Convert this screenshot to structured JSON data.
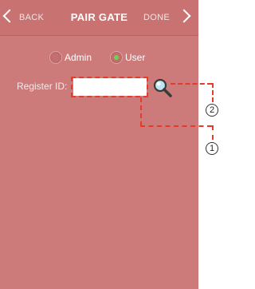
{
  "header": {
    "back_label": "BACK",
    "title": "PAIR GATE",
    "done_label": "DONE"
  },
  "role_selector": {
    "options": [
      {
        "label": "Admin",
        "selected": false
      },
      {
        "label": "User",
        "selected": true
      }
    ]
  },
  "register": {
    "label": "Register ID:",
    "value": "",
    "placeholder": ""
  },
  "annotations": {
    "callout_1": "1",
    "callout_2": "2"
  },
  "colors": {
    "background": "#cd7a7a",
    "header": "#c97272",
    "highlight": "#e53b2b",
    "radio_selected": "#6fd052"
  }
}
